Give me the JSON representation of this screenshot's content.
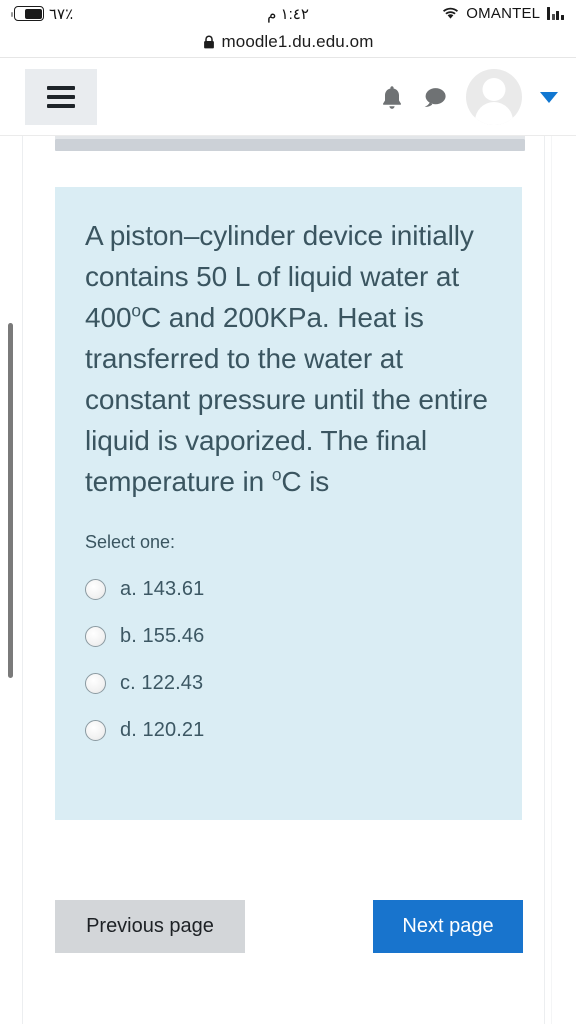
{
  "status_bar": {
    "battery_percent_label": "٪٦٧",
    "battery_level": 67,
    "time": "١:٤٢ م",
    "carrier": "OMANTEL",
    "wifi_icon": "wifi-icon",
    "signal_icon": "signal-bars-icon",
    "battery_icon": "battery-icon"
  },
  "browser": {
    "lock_icon": "lock-icon",
    "url": "moodle1.du.edu.om"
  },
  "header": {
    "menu_icon": "hamburger-menu-icon",
    "notifications_icon": "bell-icon",
    "messages_icon": "chat-bubble-icon",
    "avatar_icon": "user-avatar-icon",
    "dropdown_icon": "caret-down-icon"
  },
  "question": {
    "text_part1": "A piston–cylinder device initially contains 50 L of liquid water at 400",
    "degree_c_1": "o",
    "text_part2": "C and 200KPa. Heat is transferred to the water at constant pressure until the entire liquid is vaporized. The final temperature in ",
    "degree_c_2": "o",
    "text_part3": "C is",
    "select_label": "Select one:",
    "answers": [
      {
        "label": "a. 143.61",
        "selected": false
      },
      {
        "label": "b. 155.46",
        "selected": false
      },
      {
        "label": "c. 122.43",
        "selected": false
      },
      {
        "label": "d. 120.21",
        "selected": false
      }
    ]
  },
  "navigation": {
    "previous_label": "Previous page",
    "next_label": "Next page"
  },
  "colors": {
    "question_bg": "#daedf4",
    "question_text": "#3a5560",
    "next_button_bg": "#1874cd",
    "previous_button_bg": "#d3d6d9",
    "accent_blue": "#1177d1"
  }
}
